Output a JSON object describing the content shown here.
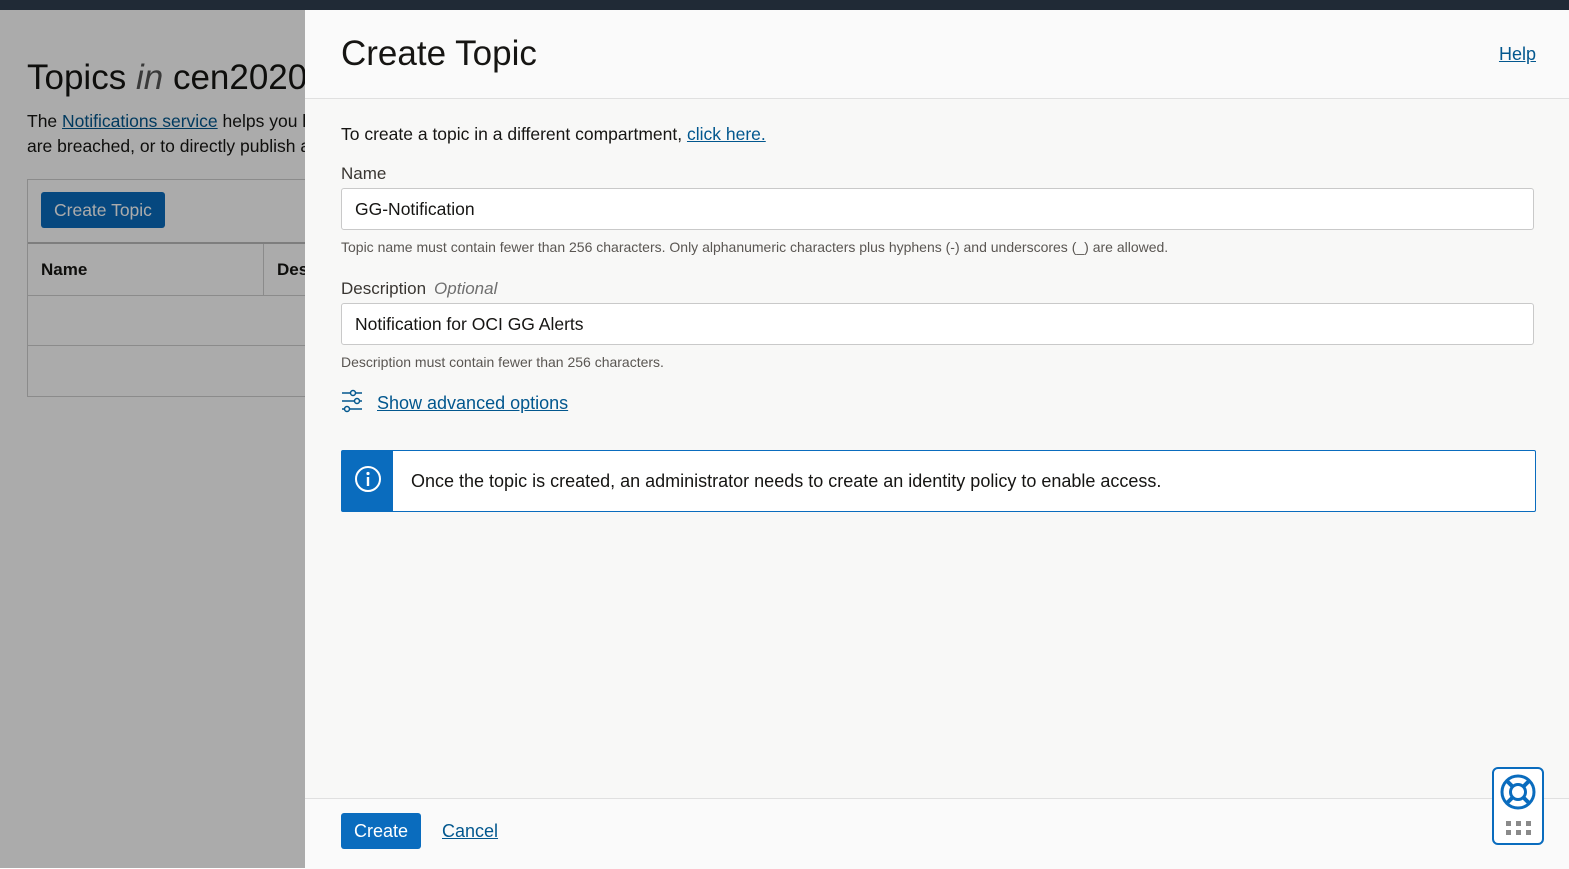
{
  "background": {
    "title_prefix": "Topics",
    "title_in": "in",
    "title_compartment": "cen2020",
    "desc_part1": "The ",
    "desc_link": "Notifications service",
    "desc_part2": " helps you l",
    "desc_line2": "are breached, or to directly publish a",
    "create_button": "Create Topic",
    "columns": [
      "Name",
      "Des"
    ]
  },
  "panel": {
    "title": "Create Topic",
    "help_link": "Help",
    "intro_text": "To create a topic in a different compartment, ",
    "intro_link": "click here.",
    "name_field": {
      "label": "Name",
      "value": "GG-Notification",
      "hint": "Topic name must contain fewer than 256 characters. Only alphanumeric characters plus hyphens (-) and underscores (_) are allowed."
    },
    "description_field": {
      "label": "Description",
      "optional": "Optional",
      "value": "Notification for OCI GG Alerts",
      "hint": "Description must contain fewer than 256 characters."
    },
    "advanced_options": "Show advanced options",
    "info_message": "Once the topic is created, an administrator needs to create an identity policy to enable access."
  },
  "footer": {
    "create_button": "Create",
    "cancel_link": "Cancel"
  },
  "icons": {
    "advanced": "sliders-icon",
    "info": "info-icon",
    "help_widget": "lifebuoy-icon"
  },
  "colors": {
    "accent": "#0a6cbe",
    "link": "#02578e",
    "topbar": "#202a36"
  }
}
